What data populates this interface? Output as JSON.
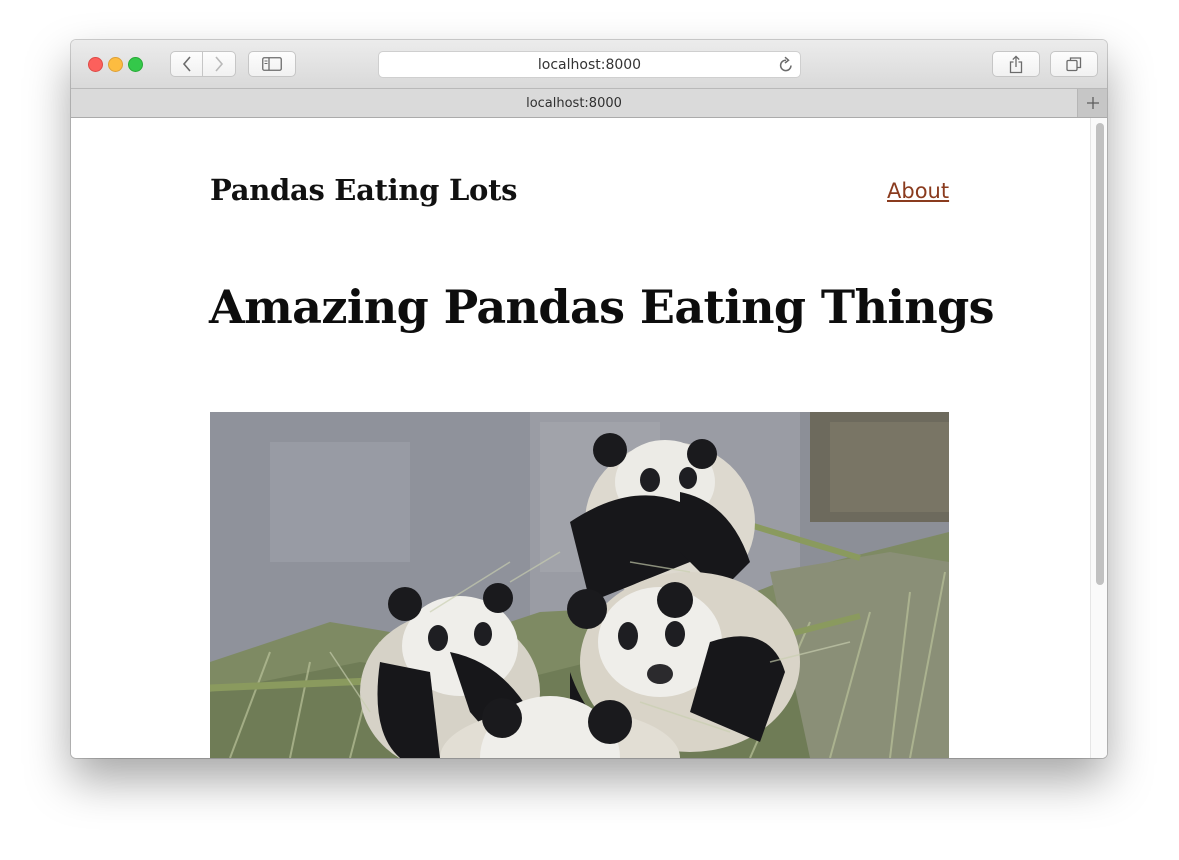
{
  "browser": {
    "url": "localhost:8000",
    "tab_title": "localhost:8000",
    "icons": {
      "back": "chevron-left-icon",
      "forward": "chevron-right-icon",
      "sidebar": "sidebar-icon",
      "reload": "reload-icon",
      "share": "share-icon",
      "tabs": "tabs-icon",
      "new_tab": "plus-icon"
    }
  },
  "page": {
    "site_title": "Pandas Eating Lots",
    "nav_about": "About",
    "heading": "Amazing Pandas Eating Things",
    "photo_subject": "panda-photo"
  },
  "colors": {
    "link": "#8a3b1e",
    "text": "#111111"
  }
}
